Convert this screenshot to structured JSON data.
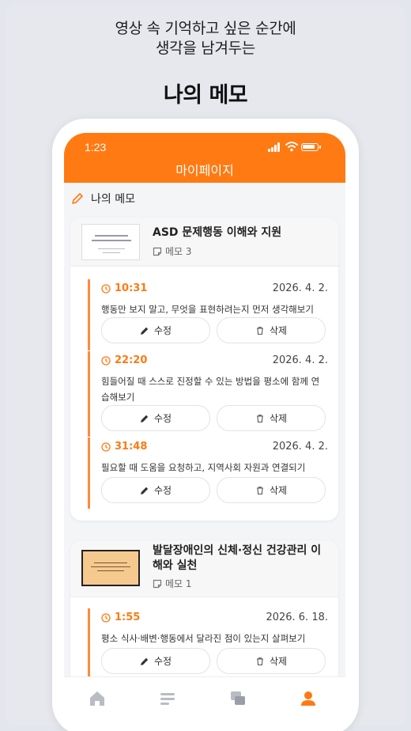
{
  "promo": {
    "line1": "영상 속 기억하고 싶은 순간에",
    "line2": "생각을 남겨두는",
    "title": "나의 메모"
  },
  "status": {
    "time": "1:23"
  },
  "header": {
    "title": "마이페이지"
  },
  "section": {
    "title": "나의 메모"
  },
  "colors": {
    "accent": "#ff7a12",
    "memo_bar": "#ff8a3d"
  },
  "cards": [
    {
      "title": "ASD 문제행동 이해와 지원",
      "memo_count": "메모 3",
      "memos": [
        {
          "time": "10:31",
          "date": "2026. 4. 2.",
          "text": "행동만 보지 말고, 무엇을 표현하려는지 먼저 생각해보기",
          "edit": "수정",
          "delete": "삭제"
        },
        {
          "time": "22:20",
          "date": "2026. 4. 2.",
          "text": "힘들어질 때 스스로 진정할 수 있는 방법을 평소에 함께 연습해보기",
          "edit": "수정",
          "delete": "삭제"
        },
        {
          "time": "31:48",
          "date": "2026. 4. 2.",
          "text": "필요할 때 도움을 요청하고, 지역사회 자원과 연결되기",
          "edit": "수정",
          "delete": "삭제"
        }
      ]
    },
    {
      "title": "발달장애인의 신체·정신 건강관리 이해와 실천",
      "memo_count": "메모 1",
      "memos": [
        {
          "time": "1:55",
          "date": "2026. 6. 18.",
          "text": "평소 식사·배변·행동에서 달라진 점이 있는지 살펴보기",
          "edit": "수정",
          "delete": "삭제"
        }
      ]
    }
  ],
  "tabbar": {
    "icons": [
      "home-icon",
      "list-icon",
      "chat-icon",
      "profile-icon"
    ],
    "active": "profile-icon"
  }
}
